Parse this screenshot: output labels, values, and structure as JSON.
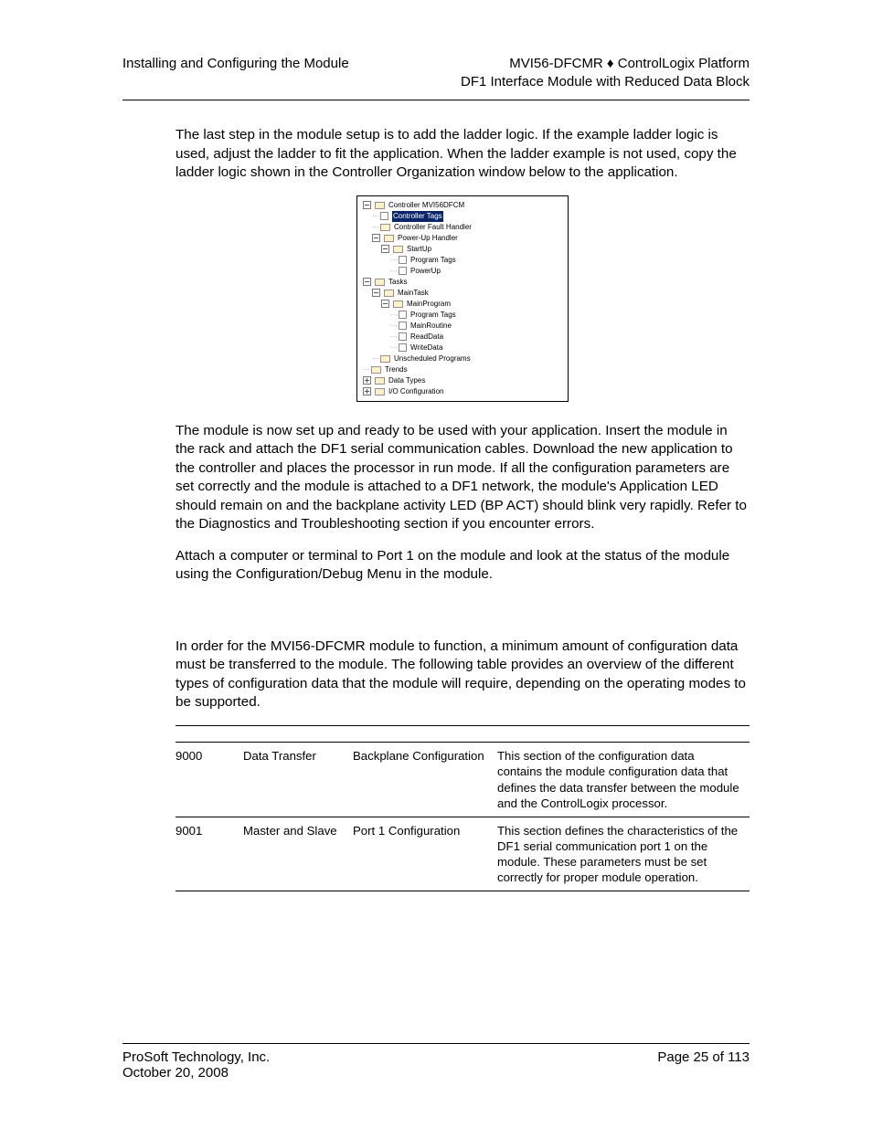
{
  "header": {
    "left": "Installing and Configuring the Module",
    "right1": "MVI56-DFCMR ♦ ControlLogix Platform",
    "right2": "DF1 Interface Module with Reduced Data Block"
  },
  "para1": "The last step in the module setup is to add the ladder logic. If the example ladder logic is used, adjust the ladder to fit the application. When the ladder example is not used, copy the ladder logic shown in the Controller Organization window below to the application.",
  "tree": {
    "controller": "Controller MVI56DFCM",
    "controller_tags": "Controller Tags",
    "controller_fault": "Controller Fault Handler",
    "powerup_handler": "Power-Up Handler",
    "startup": "StartUp",
    "program_tags1": "Program Tags",
    "powerup_routine": "PowerUp",
    "tasks": "Tasks",
    "maintask": "MainTask",
    "mainprogram": "MainProgram",
    "program_tags2": "Program Tags",
    "mainroutine": "MainRoutine",
    "readdata": "ReadData",
    "writedata": "WriteData",
    "unscheduled": "Unscheduled Programs",
    "trends": "Trends",
    "datatypes": "Data Types",
    "ioconfig": "I/O Configuration"
  },
  "para2": "The module is now set up and ready to be used with your application. Insert the module in the rack and attach the DF1 serial communication cables. Download the new application to the controller and places the processor in run mode. If all the configuration parameters are set correctly and the module is attached to a DF1 network, the module's Application LED should remain on and the backplane activity LED (BP ACT) should blink very rapidly. Refer to the Diagnostics and Troubleshooting section if you encounter errors.",
  "para3": "Attach a computer or terminal to Port 1 on the module and look at the status of the module using the Configuration/Debug Menu in the module.",
  "para4": "In order for the MVI56-DFCMR module to function, a minimum amount of configuration data must be transferred to the module. The following table provides an overview of the different types of configuration data that the module will require, depending on the operating modes to be supported.",
  "table": {
    "rows": [
      {
        "c1": "9000",
        "c2": "Data Transfer",
        "c3": "Backplane Configuration",
        "c4": "This section of the configuration data contains the module configuration data that defines the data transfer between the module and the ControlLogix processor."
      },
      {
        "c1": "9001",
        "c2": "Master and Slave",
        "c3": "Port 1 Configuration",
        "c4": "This section defines the characteristics of the DF1 serial communication port 1 on the module. These parameters must be set correctly for proper module operation."
      }
    ]
  },
  "footer": {
    "left1": "ProSoft Technology, Inc.",
    "left2": "October 20, 2008",
    "right": "Page 25 of 113"
  }
}
